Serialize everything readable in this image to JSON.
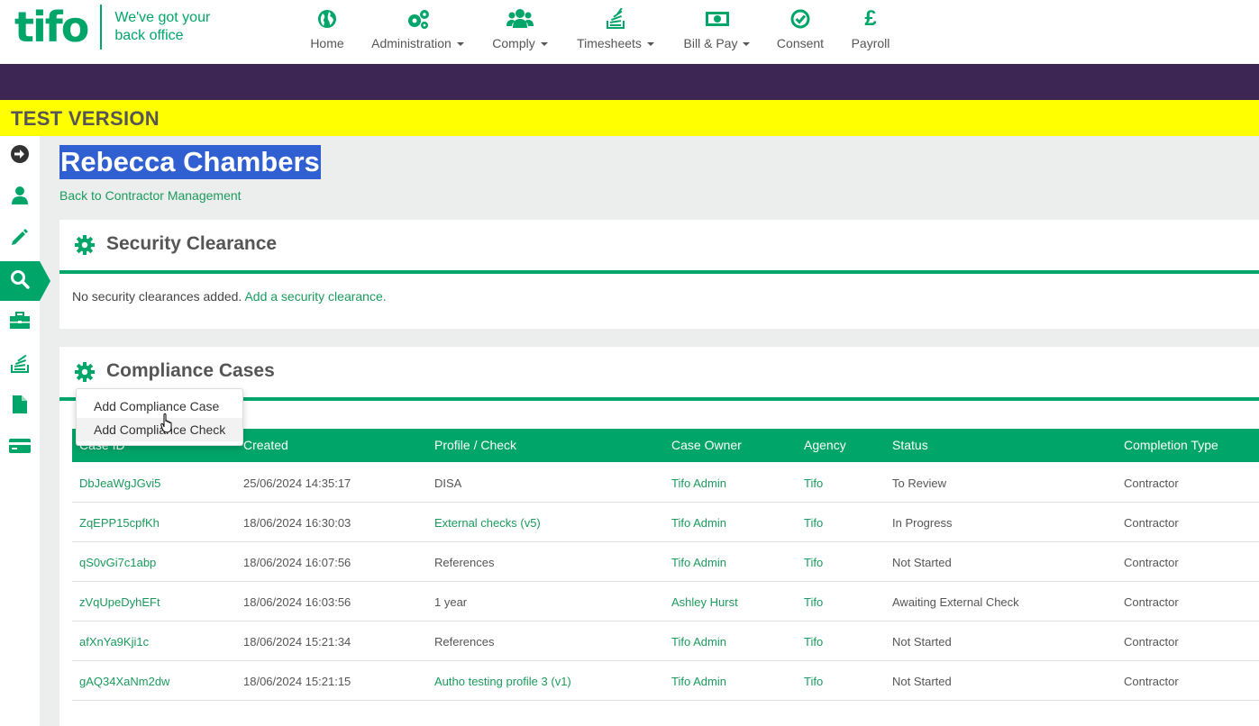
{
  "brand": {
    "logo_text": "tifo",
    "tagline_line1": "We've got your",
    "tagline_line2": "back office",
    "accent_color": "#00a56a",
    "purple_color": "#3e2654"
  },
  "nav": [
    {
      "label": "Home",
      "icon": "globe-icon"
    },
    {
      "label": "Administration",
      "icon": "gears-icon"
    },
    {
      "label": "Comply",
      "icon": "users-icon"
    },
    {
      "label": "Timesheets",
      "icon": "stack-icon"
    },
    {
      "label": "Bill & Pay",
      "icon": "money-icon"
    },
    {
      "label": "Consent",
      "icon": "check-circle-icon"
    },
    {
      "label": "Payroll",
      "icon": "pound-icon"
    }
  ],
  "banner": "TEST VERSION",
  "sidebar": [
    {
      "icon": "arrow-right-circle-icon"
    },
    {
      "icon": "user-icon"
    },
    {
      "icon": "pencil-icon"
    },
    {
      "icon": "search-icon",
      "active": true
    },
    {
      "icon": "briefcase-icon"
    },
    {
      "icon": "stack-icon"
    },
    {
      "icon": "file-icon"
    },
    {
      "icon": "credit-card-icon"
    }
  ],
  "page": {
    "title": "Rebecca Chambers",
    "back_link": "Back to Contractor Management"
  },
  "security": {
    "title": "Security Clearance",
    "empty_text": "No security clearances added.",
    "add_link": "Add a security clearance."
  },
  "compliance": {
    "title": "Compliance Cases",
    "dropdown": [
      "Add Compliance Case",
      "Add Compliance Check"
    ],
    "columns": [
      "Case ID",
      "Created",
      "Profile / Check",
      "Case Owner",
      "Agency",
      "Status",
      "Completion Type"
    ],
    "rows": [
      {
        "id": "DbJeaWgJGvi5",
        "created": "25/06/2024 14:35:17",
        "profile": "DISA",
        "owner": "Tifo Admin",
        "agency": "Tifo",
        "status": "To Review",
        "completion": "Contractor"
      },
      {
        "id": "ZqEPP15cpfKh",
        "created": "18/06/2024 16:30:03",
        "profile": "External checks (v5)",
        "owner": "Tifo Admin",
        "agency": "Tifo",
        "status": "In Progress",
        "completion": "Contractor"
      },
      {
        "id": "qS0vGi7c1abp",
        "created": "18/06/2024 16:07:56",
        "profile": "References",
        "owner": "Tifo Admin",
        "agency": "Tifo",
        "status": "Not Started",
        "completion": "Contractor"
      },
      {
        "id": "zVqUpeDyhEFt",
        "created": "18/06/2024 16:03:56",
        "profile": "1 year",
        "owner": "Ashley Hurst",
        "agency": "Tifo",
        "status": "Awaiting External Check",
        "completion": "Contractor"
      },
      {
        "id": "afXnYa9Kji1c",
        "created": "18/06/2024 15:21:34",
        "profile": "References",
        "owner": "Tifo Admin",
        "agency": "Tifo",
        "status": "Not Started",
        "completion": "Contractor"
      },
      {
        "id": "gAQ34XaNm2dw",
        "created": "18/06/2024 15:21:15",
        "profile": "Autho testing profile 3 (v1)",
        "owner": "Tifo Admin",
        "agency": "Tifo",
        "status": "Not Started",
        "completion": "Contractor"
      }
    ]
  }
}
